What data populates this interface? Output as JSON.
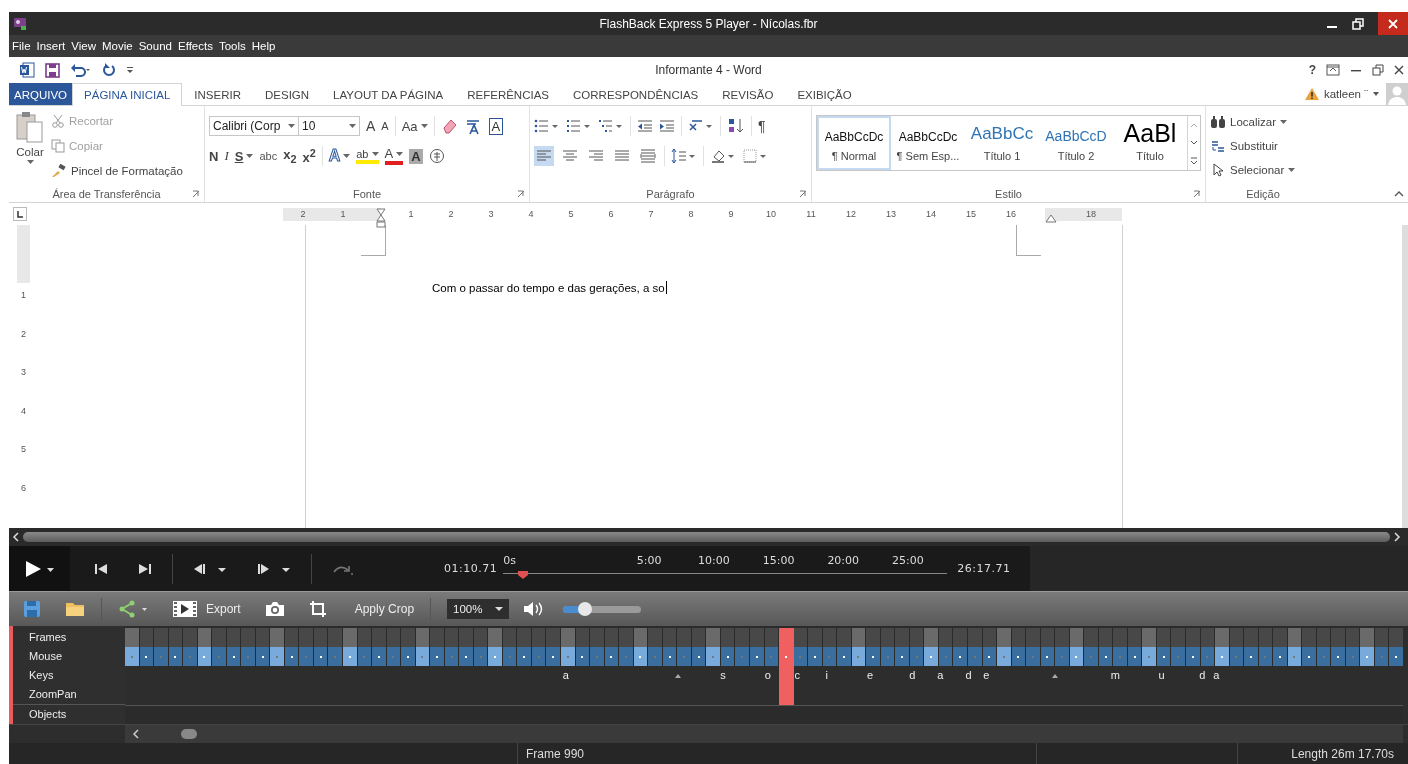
{
  "player": {
    "title": "FlashBack Express 5 Player - Nícolas.fbr",
    "menu": [
      "File",
      "Insert",
      "View",
      "Movie",
      "Sound",
      "Effects",
      "Tools",
      "Help"
    ]
  },
  "word": {
    "title": "Informante 4 - Word",
    "help": "?",
    "user": "katleen ¨",
    "tabs": [
      {
        "label": "ARQUIVO",
        "kind": "file",
        "selected": false
      },
      {
        "label": "PÁGINA INICIAL",
        "kind": "tab",
        "selected": true
      },
      {
        "label": "INSERIR",
        "kind": "tab",
        "selected": false
      },
      {
        "label": "DESIGN",
        "kind": "tab",
        "selected": false
      },
      {
        "label": "LAYOUT DA PÁGINA",
        "kind": "tab",
        "selected": false
      },
      {
        "label": "REFERÊNCIAS",
        "kind": "tab",
        "selected": false
      },
      {
        "label": "CORRESPONDÊNCIAS",
        "kind": "tab",
        "selected": false
      },
      {
        "label": "REVISÃO",
        "kind": "tab",
        "selected": false
      },
      {
        "label": "EXIBIÇÃO",
        "kind": "tab",
        "selected": false
      }
    ],
    "clipboard": {
      "paste": "Colar",
      "group": "Área de Transferência",
      "items": [
        {
          "label": "Recortar",
          "kind": "cut",
          "disabled": true
        },
        {
          "label": "Copiar",
          "kind": "copy",
          "disabled": true
        },
        {
          "label": "Pincel de Formatação",
          "kind": "painter",
          "disabled": false
        }
      ]
    },
    "font": {
      "name": "Calibri (Corp",
      "size": "10",
      "group": "Fonte",
      "row1": [
        {
          "label": "A",
          "kind": "grow"
        },
        {
          "label": "A",
          "kind": "shrink"
        },
        {
          "kind": "sep"
        },
        {
          "label": "Aa",
          "kind": "case"
        },
        {
          "kind": "sep"
        },
        {
          "kind": "clear"
        },
        {
          "kind": "phonetic"
        },
        {
          "label": "A",
          "kind": "border"
        }
      ],
      "row2": [
        {
          "label": "N",
          "kind": "bold"
        },
        {
          "label": "I",
          "kind": "italic"
        },
        {
          "label": "S",
          "kind": "underline"
        },
        {
          "label": "abc",
          "kind": "strike"
        },
        {
          "label": "x$_{2}$",
          "kind": "script"
        },
        {
          "label": "x$^{2}$",
          "kind": "script"
        },
        {
          "kind": "sep"
        },
        {
          "label": "A",
          "kind": "effect"
        },
        {
          "label": "ab",
          "kind": "highlight"
        },
        {
          "label": "A",
          "kind": "color"
        },
        {
          "label": "A",
          "kind": "shade"
        },
        {
          "kind": "enclose"
        }
      ]
    },
    "paragraph": {
      "group": "Parágrafo",
      "show_marks": "¶",
      "alignment": [
        {
          "kind": "left",
          "selected": true
        },
        {
          "kind": "center",
          "selected": false
        },
        {
          "kind": "right",
          "selected": false
        },
        {
          "kind": "justify",
          "selected": false
        },
        {
          "kind": "distributed",
          "selected": false
        }
      ]
    },
    "styles": {
      "group": "Estilo",
      "items": [
        {
          "preview": "AaBbCcDc",
          "name": "¶ Normal",
          "kind": "normal",
          "selected": true
        },
        {
          "preview": "AaBbCcDc",
          "name": "¶ Sem Esp...",
          "kind": "normal",
          "selected": false
        },
        {
          "preview": "AaBbCc",
          "name": "Título 1",
          "kind": "heading1",
          "selected": false
        },
        {
          "preview": "AaBbCcD",
          "name": "Título 2",
          "kind": "heading2",
          "selected": false
        },
        {
          "preview": "AaBl",
          "name": "Título",
          "kind": "title",
          "selected": false
        }
      ]
    },
    "editing": {
      "group": "Edição",
      "items": [
        {
          "label": "Localizar",
          "kind": "find"
        },
        {
          "label": "Substituir",
          "kind": "replace"
        },
        {
          "label": "Selecionar",
          "kind": "select"
        }
      ]
    },
    "ruler": {
      "before": [
        "2",
        "1"
      ],
      "after": [
        "1",
        "2",
        "3",
        "4",
        "5",
        "6",
        "7",
        "8",
        "9",
        "10",
        "11",
        "12",
        "13",
        "14",
        "15",
        "16"
      ],
      "end": [
        "18"
      ],
      "vertical": [
        "1",
        "2",
        "3",
        "4",
        "5",
        "6"
      ]
    },
    "document": {
      "text": "Com o passar do tempo e das gerações, a so"
    }
  },
  "controls": {
    "position": "01:10.71",
    "ticks": [
      "0s",
      "5:00",
      "10:00",
      "15:00",
      "20:00",
      "25:00"
    ],
    "length": "26:17.71",
    "seek": {
      "level": 0.045
    }
  },
  "toolbar": {
    "export": "Export",
    "apply_crop": "Apply Crop",
    "zoom": "100%",
    "volume": {
      "level": 0.28
    }
  },
  "timeline": {
    "playhead": {
      "level": 0.515
    },
    "tracks": [
      {
        "label": "Frames",
        "kind": "frames"
      },
      {
        "label": "Mouse",
        "kind": "mouse"
      },
      {
        "label": "Keys",
        "kind": "keys"
      },
      {
        "label": "ZoomPan",
        "kind": "zoompan"
      },
      {
        "label": "Objects",
        "kind": "objects"
      }
    ],
    "keys": [
      {
        "label": "a",
        "kind": "char",
        "level": 0.345
      },
      {
        "kind": "caret",
        "level": 0.433
      },
      {
        "label": "s",
        "kind": "char",
        "level": 0.468
      },
      {
        "label": "o",
        "kind": "char",
        "level": 0.503
      },
      {
        "label": "c",
        "kind": "char",
        "level": 0.526
      },
      {
        "label": "i",
        "kind": "char",
        "level": 0.549
      },
      {
        "label": "e",
        "kind": "char",
        "level": 0.583
      },
      {
        "label": "d",
        "kind": "char",
        "level": 0.616
      },
      {
        "label": "a",
        "kind": "char",
        "level": 0.638
      },
      {
        "label": "d",
        "kind": "char",
        "level": 0.66
      },
      {
        "label": "e",
        "kind": "char",
        "level": 0.674
      },
      {
        "kind": "caret",
        "level": 0.728
      },
      {
        "label": "m",
        "kind": "char",
        "level": 0.775
      },
      {
        "label": "u",
        "kind": "char",
        "level": 0.811
      },
      {
        "label": "d",
        "kind": "char",
        "level": 0.843
      },
      {
        "label": "a",
        "kind": "char",
        "level": 0.854
      }
    ]
  },
  "status_bar": {
    "frame": "Frame 990",
    "length": "Length 26m 17.70s"
  }
}
